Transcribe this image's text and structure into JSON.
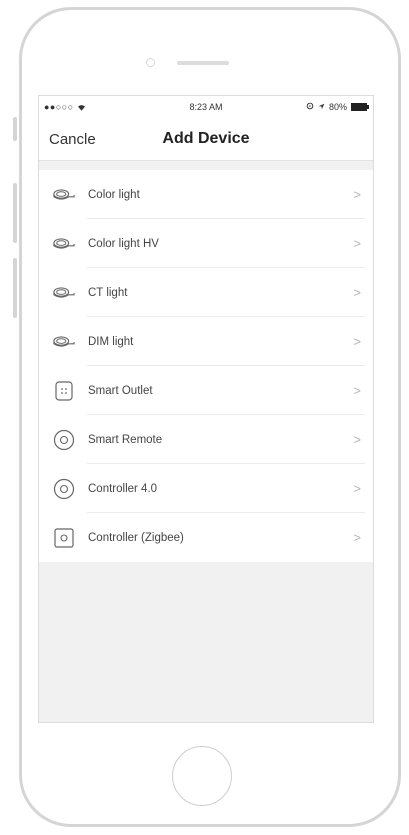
{
  "status_bar": {
    "signal": "●●○○○",
    "time": "8:23 AM",
    "battery_text": "80%"
  },
  "nav": {
    "cancel_label": "Cancle",
    "title": "Add Device"
  },
  "devices": [
    {
      "label": "Color light",
      "icon": "light-strip-icon"
    },
    {
      "label": "Color light HV",
      "icon": "light-strip-icon"
    },
    {
      "label": "CT light",
      "icon": "light-strip-icon"
    },
    {
      "label": "DIM light",
      "icon": "light-strip-icon"
    },
    {
      "label": "Smart Outlet",
      "icon": "outlet-icon"
    },
    {
      "label": "Smart Remote",
      "icon": "remote-icon"
    },
    {
      "label": "Controller 4.0",
      "icon": "controller-icon"
    },
    {
      "label": "Controller (Zigbee)",
      "icon": "zigbee-controller-icon"
    }
  ],
  "chevron": ">"
}
